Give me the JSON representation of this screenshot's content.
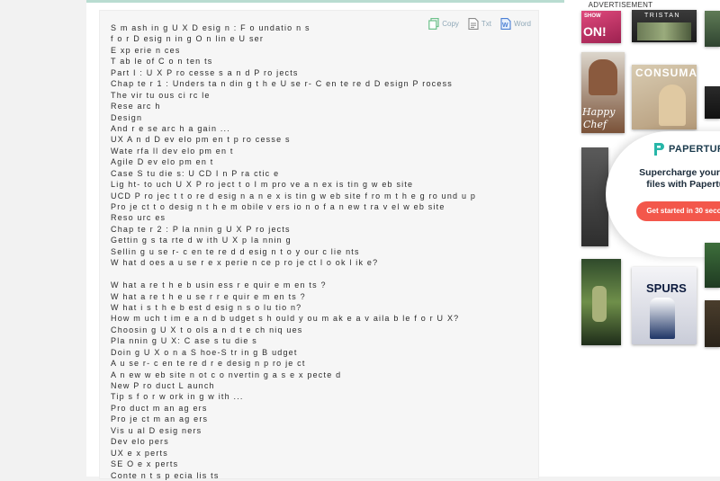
{
  "doc_actions": {
    "copy": "Copy",
    "txt": "Txt",
    "word": "Word"
  },
  "doc_lines": [
    "S m ash in g U X D esig n : F o undatio n s",
    "f o r D esig n in g O n lin e U ser",
    "E xp erie n ces",
    "T ab le of C o n ten ts",
    "Part I : U X P ro cesse s a n d P ro jects",
    "Chap te r 1 : Unders ta n din g t h e U se r- C en te re d D esign P rocess",
    "The vir tu ous ci rc le",
    "Rese arc h",
    "Design",
    "And r e se arc h a gain ...",
    "UX A n d D ev elo pm en t p ro cesse s",
    "Wate rfa ll dev elo pm en t",
    "Agile D ev elo pm en t",
    "Case S tu die s: U CD I n P ra ctic e",
    "Lig ht- to uch U X P ro ject t o I m pro ve a n ex is tin g w eb site",
    "UCD P ro jec t t o re d esig n a n e x is tin g w eb site f ro m t h e g ro und u p",
    "Pro je ct t o desig n t h e m obile v ers io n o f a n ew t ra v el w eb site",
    "Reso urc es",
    "Chap te r 2 : P la nnin g U X P ro jects",
    "Gettin g s ta rte d w ith U X p la nnin g",
    "Sellin g u se r- c en te re d d esig n t o y our c lie nts",
    "W hat d oes a u se r e x perie n ce p ro je ct l o ok l ik e?",
    "",
    "W hat a re t h e b usin ess r e quir e m en ts ?",
    "W hat a re t h e u se r r e quir e m en ts ?",
    "W hat i s t h e b est d esig n s o lu tio n?",
    "How m uch t im e a n d b udget s h ould y ou m ak e a v aila b le f o r U X?",
    "Choosin g U X t o ols a n d t e ch niq ues",
    "Pla nnin g U X: C ase s tu die s",
    "Doin g U X o n a S hoe-S tr in g B udget",
    "A u se r- c en te re d r e desig n p ro je ct",
    "A n ew w eb site n ot c o nvertin g a s e x pecte d",
    "New P ro duct L aunch",
    "Tip s f o r w ork in g w ith ...",
    "Pro duct m an ag ers",
    "Pro je ct m an ag ers",
    "Vis u al D esig ners",
    "Dev elo pers",
    "UX e x perts",
    "SE O e x perts",
    "Conte n t s p ecia lis ts"
  ],
  "sidebar": {
    "ad_label": "ADVERTISEMENT",
    "promo": {
      "brand": "PAPERTURN",
      "headline": "Supercharge your PDF files with Paperturn",
      "cta": "Get started in 30 seconds"
    },
    "thumbs": {
      "show": "SHOW",
      "on": "ON!",
      "tristan": "TRISTAN",
      "consuma": "CONSUMA",
      "happy": "Happy",
      "chef": "Chef",
      "spurs": "SPURS"
    }
  },
  "colors": {
    "promo_cta": "#f3574b",
    "promo_brand": "#1b3b4d",
    "copy_icon": "#6cc18a",
    "txt_icon": "#8a8a8a",
    "word_icon": "#4a7fd4"
  }
}
